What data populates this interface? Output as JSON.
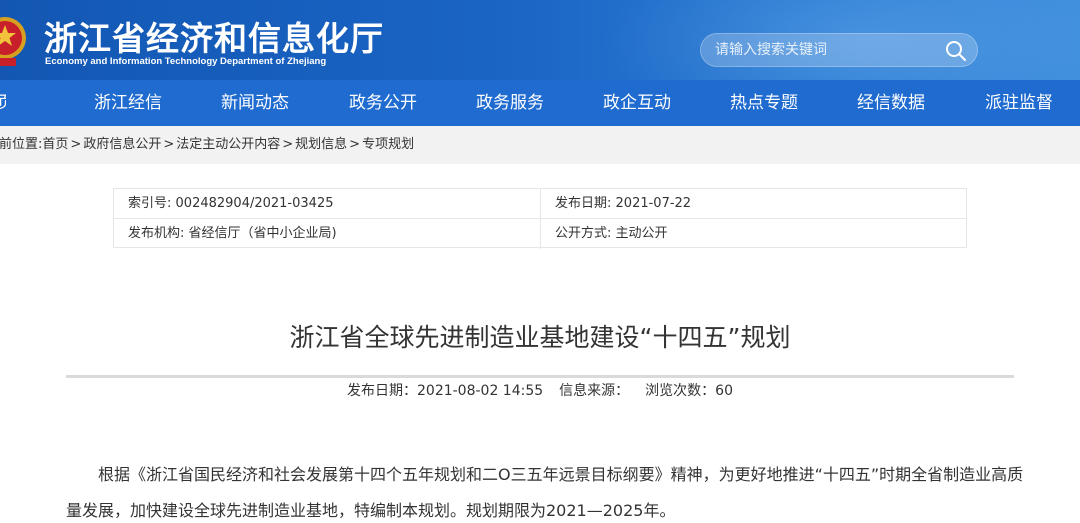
{
  "header": {
    "title": "浙江省经济和信息化厅",
    "subtitle": "Economy and Information Technology Department of Zhejiang",
    "emblem_icon": "national-emblem-icon"
  },
  "search": {
    "placeholder": "请输入搜索关键词",
    "icon": "search-icon"
  },
  "nav": {
    "partial_first": "首页",
    "items": [
      "浙江经信",
      "新闻动态",
      "政务公开",
      "政务服务",
      "政企互动",
      "热点专题",
      "经信数据",
      "派驻监督"
    ]
  },
  "breadcrumb": {
    "prefix": "当前位置:",
    "items": [
      "首页",
      "政府信息公开",
      "法定主动公开内容",
      "规划信息",
      "专项规划"
    ],
    "separator": ">"
  },
  "info": {
    "index_label": "索引号:",
    "index_value": "002482904/2021-03425",
    "pub_date_label": "发布日期:",
    "pub_date_value": "2021-07-22",
    "org_label": "发布机构:",
    "org_value": "省经信厅（省中小企业局)",
    "method_label": "公开方式:",
    "method_value": "主动公开"
  },
  "article": {
    "title": "浙江省全球先进制造业基地建设“十四五”规划",
    "meta_date": "发布日期：2021-08-02 14:55",
    "meta_source": "信息来源：",
    "meta_views": "浏览次数：60",
    "paragraph": "根据《浙江省国民经济和社会发展第十四个五年规划和二O三五年远景目标纲要》精神，为更好地推进“十四五”时期全省制造业高质量发展，加快建设全球先进制造业基地，特编制本规划。规划期限为2021—2025年。"
  },
  "colors": {
    "header_blue": "#1357b3",
    "nav_blue": "#1f6bd0",
    "breadcrumb_bg": "#f2f2f2"
  }
}
